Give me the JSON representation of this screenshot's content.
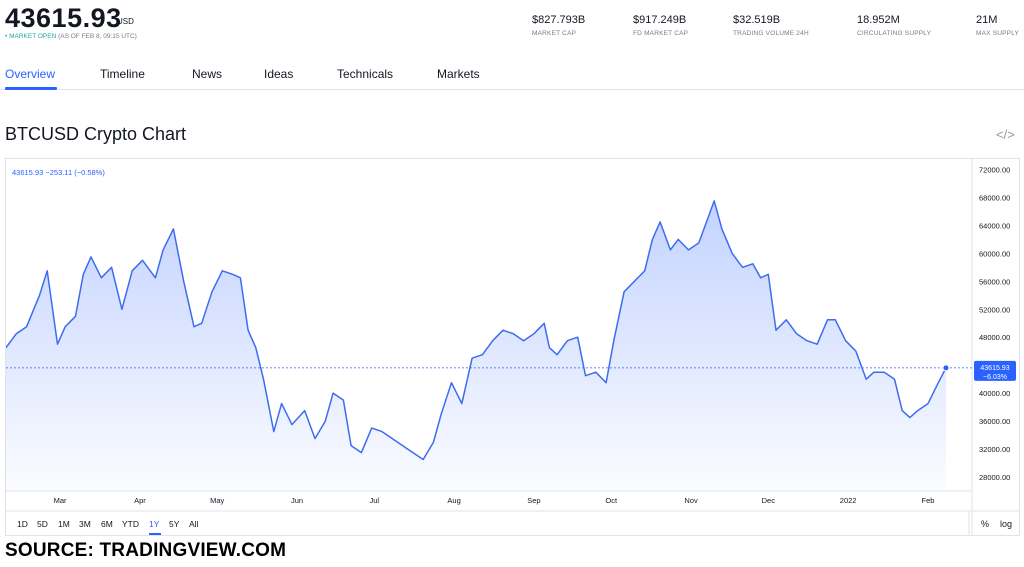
{
  "header": {
    "price": "43615.93",
    "currency": "USD",
    "market_status": "• MARKET OPEN",
    "as_of": "(AS OF FEB 8, 09:15 UTC)",
    "stats": [
      {
        "value": "$827.793B",
        "label": "MARKET CAP"
      },
      {
        "value": "$917.249B",
        "label": "FD MARKET CAP"
      },
      {
        "value": "$32.519B",
        "label": "TRADING VOLUME 24H"
      },
      {
        "value": "18.952M",
        "label": "CIRCULATING SUPPLY"
      },
      {
        "value": "21M",
        "label": "MAX SUPPLY"
      }
    ]
  },
  "tabs": [
    "Overview",
    "Timeline",
    "News",
    "Ideas",
    "Technicals",
    "Markets"
  ],
  "active_tab": "Overview",
  "page_title": "BTCUSD Crypto Chart",
  "embed_icon": "</>",
  "chart_legend": "43615.93  −253.11 (−0.58%)",
  "price_tag": {
    "price": "43615.93",
    "change": "−6.03%"
  },
  "ranges": [
    "1D",
    "5D",
    "1M",
    "3M",
    "6M",
    "YTD",
    "1Y",
    "5Y",
    "All"
  ],
  "active_range": "1Y",
  "scale_options": [
    "%",
    "log"
  ],
  "source": "SOURCE: TRADINGVIEW.COM",
  "colors": {
    "accent": "#2962ff",
    "line": "#3d6cf0",
    "text": "#131722",
    "muted": "#787b86"
  },
  "chart_data": {
    "type": "area",
    "ylim": [
      26000,
      73500
    ],
    "y_ticks": [
      "72000.00",
      "68000.00",
      "64000.00",
      "60000.00",
      "56000.00",
      "52000.00",
      "48000.00",
      "44000.00",
      "40000.00",
      "36000.00",
      "32000.00",
      "28000.00"
    ],
    "x_ticks": [
      "Mar",
      "Apr",
      "May",
      "Jun",
      "Jul",
      "Aug",
      "Sep",
      "Oct",
      "Nov",
      "Dec",
      "2022",
      "Feb"
    ],
    "last_price": 43615.93,
    "x": [
      "2021-02-08",
      "2021-02-12",
      "2021-02-16",
      "2021-02-21",
      "2021-02-24",
      "2021-02-28",
      "2021-03-03",
      "2021-03-07",
      "2021-03-10",
      "2021-03-13",
      "2021-03-17",
      "2021-03-21",
      "2021-03-25",
      "2021-03-29",
      "2021-04-02",
      "2021-04-07",
      "2021-04-10",
      "2021-04-14",
      "2021-04-18",
      "2021-04-22",
      "2021-04-25",
      "2021-04-29",
      "2021-05-03",
      "2021-05-07",
      "2021-05-10",
      "2021-05-13",
      "2021-05-16",
      "2021-05-19",
      "2021-05-23",
      "2021-05-26",
      "2021-05-30",
      "2021-06-04",
      "2021-06-08",
      "2021-06-12",
      "2021-06-15",
      "2021-06-19",
      "2021-06-22",
      "2021-06-26",
      "2021-06-30",
      "2021-07-04",
      "2021-07-08",
      "2021-07-12",
      "2021-07-16",
      "2021-07-20",
      "2021-07-24",
      "2021-07-27",
      "2021-07-31",
      "2021-08-04",
      "2021-08-08",
      "2021-08-12",
      "2021-08-16",
      "2021-08-20",
      "2021-08-24",
      "2021-08-28",
      "2021-09-01",
      "2021-09-05",
      "2021-09-07",
      "2021-09-10",
      "2021-09-14",
      "2021-09-18",
      "2021-09-21",
      "2021-09-25",
      "2021-09-29",
      "2021-10-02",
      "2021-10-06",
      "2021-10-10",
      "2021-10-14",
      "2021-10-17",
      "2021-10-20",
      "2021-10-24",
      "2021-10-27",
      "2021-10-31",
      "2021-11-04",
      "2021-11-08",
      "2021-11-10",
      "2021-11-13",
      "2021-11-17",
      "2021-11-21",
      "2021-11-25",
      "2021-11-28",
      "2021-12-01",
      "2021-12-04",
      "2021-12-08",
      "2021-12-12",
      "2021-12-16",
      "2021-12-20",
      "2021-12-24",
      "2021-12-27",
      "2021-12-31",
      "2022-01-04",
      "2022-01-08",
      "2022-01-11",
      "2022-01-15",
      "2022-01-19",
      "2022-01-22",
      "2022-01-25",
      "2022-01-28",
      "2022-02-01",
      "2022-02-05",
      "2022-02-08"
    ],
    "values": [
      46500,
      48500,
      49500,
      54000,
      57500,
      47000,
      49500,
      51000,
      57000,
      59500,
      56500,
      58000,
      52000,
      57500,
      59000,
      56500,
      60500,
      63500,
      56000,
      49500,
      50000,
      54500,
      57500,
      57000,
      56500,
      49000,
      46500,
      42000,
      34500,
      38500,
      35500,
      37500,
      33500,
      36000,
      40000,
      39000,
      32500,
      31500,
      35000,
      34500,
      33500,
      32500,
      31500,
      30500,
      33000,
      37000,
      41500,
      38500,
      45000,
      45500,
      47500,
      49000,
      48500,
      47500,
      48500,
      50000,
      46500,
      45500,
      47500,
      48000,
      42500,
      43000,
      41500,
      47500,
      54500,
      56000,
      57500,
      62000,
      64500,
      60500,
      62000,
      60500,
      61500,
      65500,
      67500,
      63500,
      60000,
      58000,
      58500,
      56500,
      57000,
      49000,
      50500,
      48500,
      47500,
      47000,
      50500,
      50500,
      47500,
      46000,
      42000,
      43000,
      43000,
      42000,
      37500,
      36500,
      37500,
      38500,
      41500,
      43615.93
    ]
  }
}
